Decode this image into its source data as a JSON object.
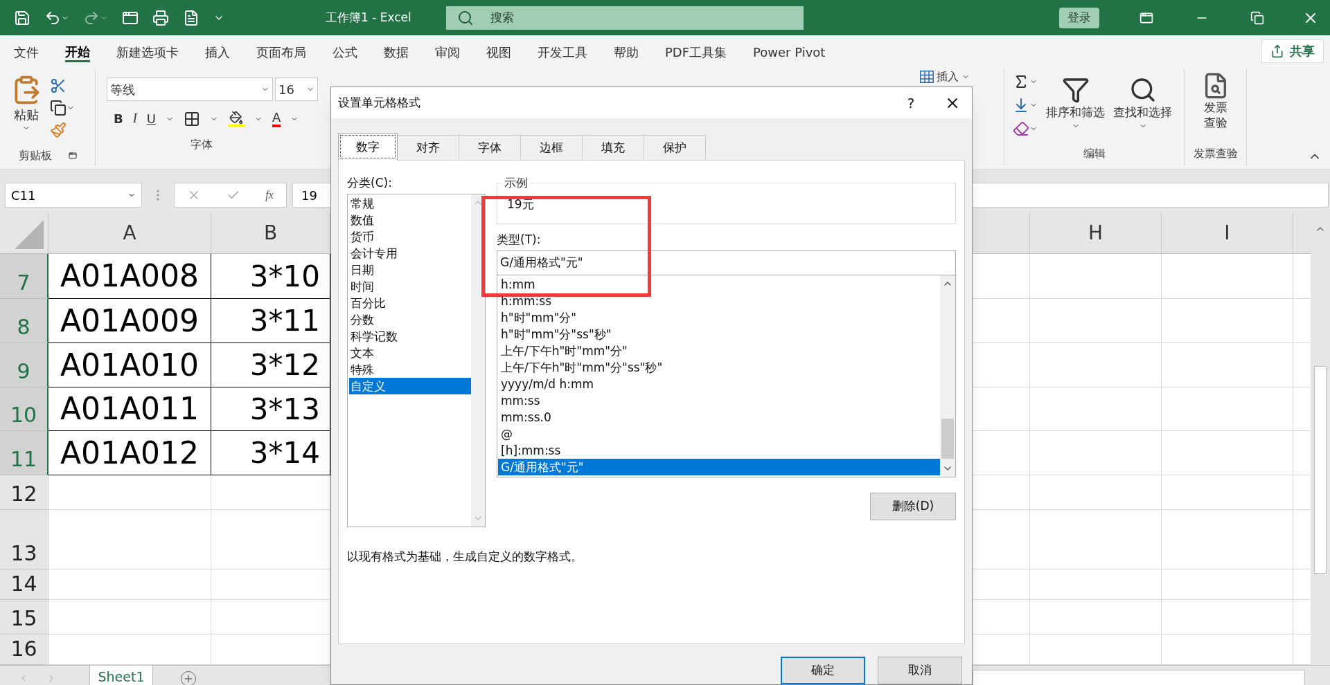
{
  "window": {
    "title": "工作簿1  -  Excel",
    "search_placeholder": "搜索",
    "sign_in": "登录"
  },
  "menu_tabs": [
    {
      "label": "文件",
      "selected": false
    },
    {
      "label": "开始",
      "selected": true
    },
    {
      "label": "新建选项卡",
      "selected": false
    },
    {
      "label": "插入",
      "selected": false
    },
    {
      "label": "页面布局",
      "selected": false
    },
    {
      "label": "公式",
      "selected": false
    },
    {
      "label": "数据",
      "selected": false
    },
    {
      "label": "审阅",
      "selected": false
    },
    {
      "label": "视图",
      "selected": false
    },
    {
      "label": "开发工具",
      "selected": false
    },
    {
      "label": "帮助",
      "selected": false
    },
    {
      "label": "PDF工具集",
      "selected": false
    },
    {
      "label": "Power Pivot",
      "selected": false
    }
  ],
  "share_button": "共享",
  "ribbon": {
    "clipboard": {
      "paste": "粘贴",
      "label": "剪贴板"
    },
    "font": {
      "font_name": "等线",
      "font_size": "16",
      "bold": "B",
      "italic": "I",
      "underline": "U",
      "font_color": "A",
      "label": "字体"
    },
    "cells": {
      "insert": "插入"
    },
    "editing": {
      "sort_filter": "排序和筛选",
      "find_select": "查找和选择",
      "label": "编辑"
    },
    "invoice": {
      "button_lines": [
        "发票",
        "查验"
      ],
      "label": "发票查验"
    }
  },
  "formula_bar": {
    "name_box": "C11",
    "function_label": "fx",
    "value": "19"
  },
  "sheet": {
    "columns": [
      "A",
      "B",
      "H",
      "I"
    ],
    "rows": [
      {
        "header": "7",
        "selected": true,
        "cells": [
          "A01A008",
          "3*10"
        ]
      },
      {
        "header": "8",
        "selected": true,
        "cells": [
          "A01A009",
          "3*11"
        ]
      },
      {
        "header": "9",
        "selected": true,
        "cells": [
          "A01A010",
          "3*12"
        ]
      },
      {
        "header": "10",
        "selected": true,
        "cells": [
          "A01A011",
          "3*13"
        ]
      },
      {
        "header": "11",
        "selected": true,
        "cells": [
          "A01A012",
          "3*14"
        ]
      },
      {
        "header": "12",
        "selected": false
      },
      {
        "header": "13",
        "selected": false
      },
      {
        "header": "14",
        "selected": false
      },
      {
        "header": "15",
        "selected": false
      },
      {
        "header": "16",
        "selected": false
      }
    ]
  },
  "sheet_tabs": [
    {
      "label": "Sheet1",
      "selected": true
    }
  ],
  "dialog": {
    "title": "设置单元格格式",
    "help": "?",
    "tabs": [
      {
        "label": "数字",
        "selected": true
      },
      {
        "label": "对齐",
        "selected": false
      },
      {
        "label": "字体",
        "selected": false
      },
      {
        "label": "边框",
        "selected": false
      },
      {
        "label": "填充",
        "selected": false
      },
      {
        "label": "保护",
        "selected": false
      }
    ],
    "category_label": "分类(C):",
    "categories": [
      {
        "label": "常规",
        "selected": false
      },
      {
        "label": "数值",
        "selected": false
      },
      {
        "label": "货币",
        "selected": false
      },
      {
        "label": "会计专用",
        "selected": false
      },
      {
        "label": "日期",
        "selected": false
      },
      {
        "label": "时间",
        "selected": false
      },
      {
        "label": "百分比",
        "selected": false
      },
      {
        "label": "分数",
        "selected": false
      },
      {
        "label": "科学记数",
        "selected": false
      },
      {
        "label": "文本",
        "selected": false
      },
      {
        "label": "特殊",
        "selected": false
      },
      {
        "label": "自定义",
        "selected": true
      }
    ],
    "sample_label": "示例",
    "sample_value": "19元",
    "type_label": "类型(T):",
    "type_value": "G/通用格式\"元\"",
    "types": [
      {
        "label": "h:mm",
        "selected": false
      },
      {
        "label": "h:mm:ss",
        "selected": false
      },
      {
        "label": "h\"时\"mm\"分\"",
        "selected": false
      },
      {
        "label": "h\"时\"mm\"分\"ss\"秒\"",
        "selected": false
      },
      {
        "label": "上午/下午h\"时\"mm\"分\"",
        "selected": false
      },
      {
        "label": "上午/下午h\"时\"mm\"分\"ss\"秒\"",
        "selected": false
      },
      {
        "label": "yyyy/m/d h:mm",
        "selected": false
      },
      {
        "label": "mm:ss",
        "selected": false
      },
      {
        "label": "mm:ss.0",
        "selected": false
      },
      {
        "label": "@",
        "selected": false
      },
      {
        "label": "[h]:mm:ss",
        "selected": false
      },
      {
        "label": "G/通用格式\"元\"",
        "selected": true
      }
    ],
    "delete_button": "删除(D)",
    "description": "以现有格式为基础，生成自定义的数字格式。",
    "ok_button": "确定",
    "cancel_button": "取消"
  }
}
